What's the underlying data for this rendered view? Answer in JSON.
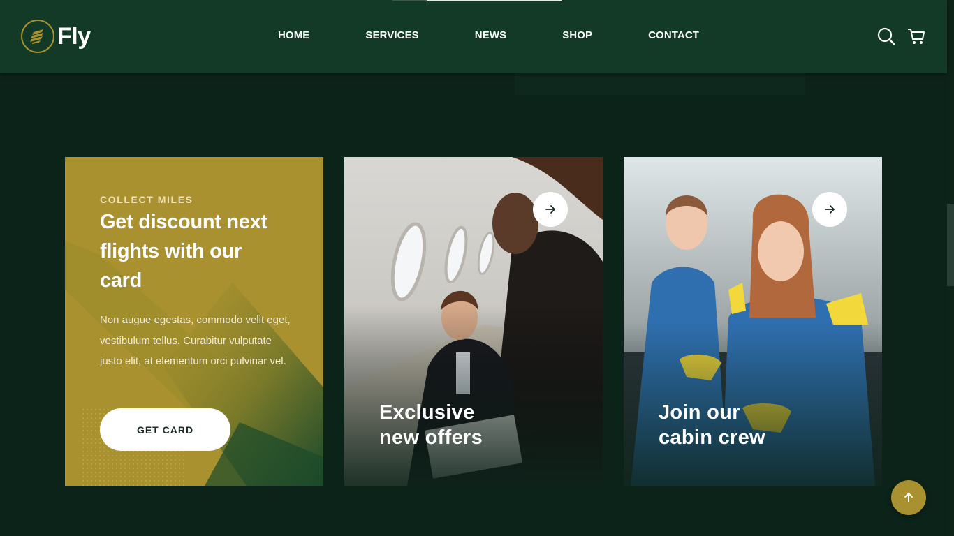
{
  "header": {
    "logo_text": "Fly",
    "nav": [
      "HOME",
      "SERVICES",
      "NEWS",
      "SHOP",
      "CONTACT"
    ],
    "icons": [
      "search-icon",
      "cart-icon"
    ]
  },
  "promo": {
    "eyebrow": "COLLECT MILES",
    "title": "Get discount next flights with our card",
    "text": "Non augue egestas, commodo velit eget, vestibulum tellus. Curabitur vulputate justo elit, at elementum orci pulvinar vel.",
    "button": "GET CARD"
  },
  "cards": [
    {
      "title_line1": "Exclusive",
      "title_line2": "new offers",
      "icon": "arrow-right-icon"
    },
    {
      "title_line1": "Join our",
      "title_line2": "cabin crew",
      "icon": "arrow-right-icon"
    }
  ],
  "back_to_top_icon": "arrow-up-icon",
  "colors": {
    "header_bg": "#123a26",
    "page_bg": "#0c2319",
    "accent_gold": "#a8912e",
    "text_white": "#ffffff"
  }
}
